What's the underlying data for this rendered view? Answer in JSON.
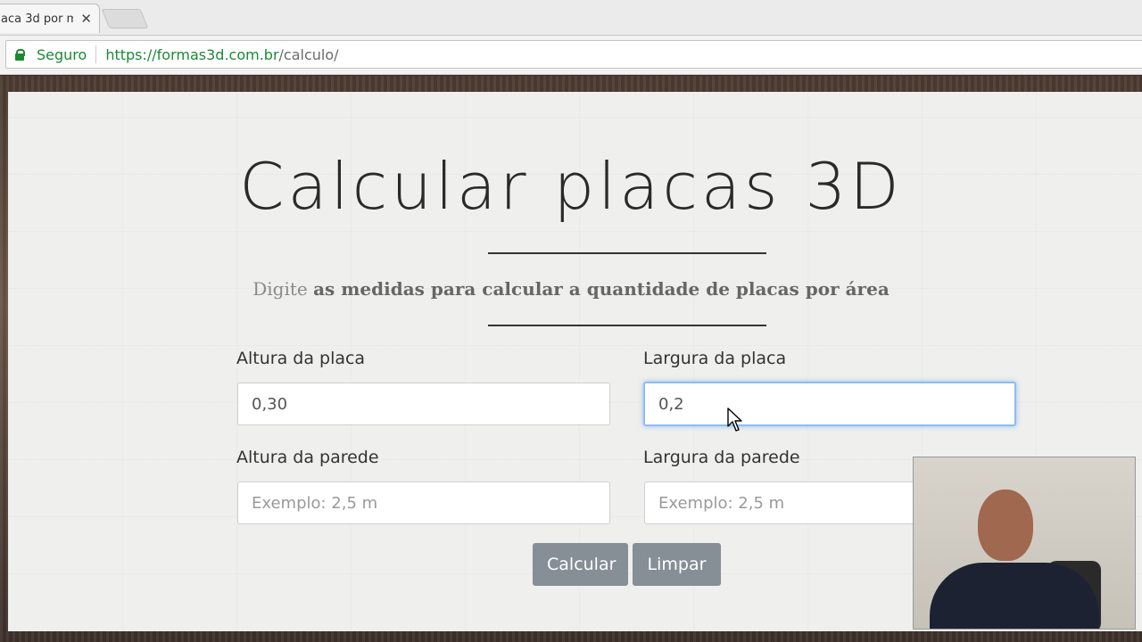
{
  "browser": {
    "tab_title": "aca 3d por m",
    "tab_close": "✕",
    "secure_label": "Seguro",
    "url_host": "https://formas3d.com.br",
    "url_path": "/calculo/"
  },
  "page": {
    "title": "Calcular placas 3D",
    "subtitle_light": "Digite",
    "subtitle_bold": "as medidas para calcular a quantidade de placas por área"
  },
  "form": {
    "altura_placa": {
      "label": "Altura da placa",
      "value": "0,30"
    },
    "largura_placa": {
      "label": "Largura da placa",
      "value": "0,2"
    },
    "altura_parede": {
      "label": "Altura da parede",
      "placeholder": "Exemplo: 2,5 m"
    },
    "largura_parede": {
      "label": "Largura da parede",
      "placeholder": "Exemplo: 2,5 m"
    }
  },
  "buttons": {
    "calcular": "Calcular",
    "limpar": "Limpar"
  },
  "colors": {
    "secure_green": "#1a8a34",
    "button_gray": "#868e96",
    "focus_ring": "#8fbcef"
  }
}
